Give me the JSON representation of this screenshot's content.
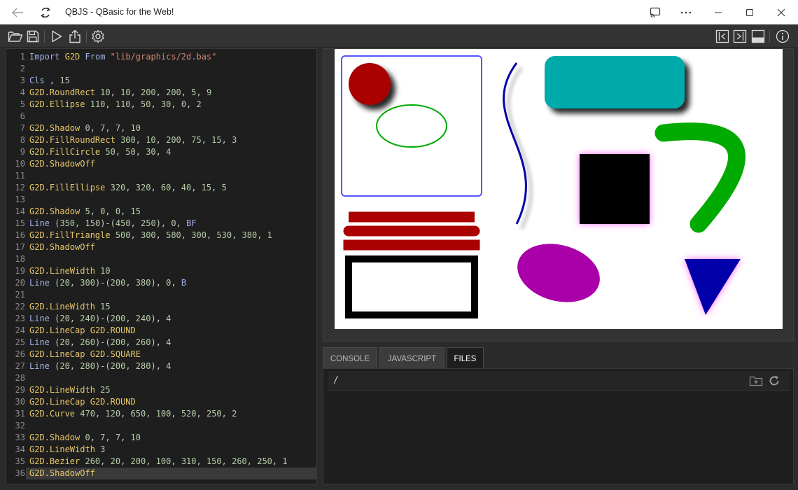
{
  "window": {
    "title": "QBJS - QBasic for the Web!"
  },
  "toolbar": {
    "left_icons": [
      "open-folder-icon",
      "save-icon",
      "run-icon",
      "share-icon",
      "settings-icon"
    ],
    "right_icons": [
      "collapse-left-icon",
      "collapse-right-icon",
      "bottom-panel-icon",
      "info-icon"
    ]
  },
  "editor": {
    "lines": [
      "Import G2D From \"lib/graphics/2d.bas\"",
      "",
      "Cls , 15",
      "G2D.RoundRect 10, 10, 200, 200, 5, 9",
      "G2D.Ellipse 110, 110, 50, 30, 0, 2",
      "",
      "G2D.Shadow 0, 7, 7, 10",
      "G2D.FillRoundRect 300, 10, 200, 75, 15, 3",
      "G2D.FillCircle 50, 50, 30, 4",
      "G2D.ShadowOff",
      "",
      "G2D.FillEllipse 320, 320, 60, 40, 15, 5",
      "",
      "G2D.Shadow 5, 0, 0, 15",
      "Line (350, 150)-(450, 250), 0, BF",
      "G2D.FillTriangle 500, 300, 580, 300, 530, 380, 1",
      "G2D.ShadowOff",
      "",
      "G2D.LineWidth 10",
      "Line (20, 300)-(200, 380), 0, B",
      "",
      "G2D.LineWidth 15",
      "Line (20, 240)-(200, 240), 4",
      "G2D.LineCap G2D.ROUND",
      "Line (20, 260)-(200, 260), 4",
      "G2D.LineCap G2D.SQUARE",
      "Line (20, 280)-(200, 280), 4",
      "",
      "G2D.LineWidth 25",
      "G2D.LineCap G2D.ROUND",
      "G2D.Curve 470, 120, 650, 100, 520, 250, 2",
      "",
      "G2D.Shadow 0, 7, 7, 10",
      "G2D.LineWidth 3",
      "G2D.Bezier 260, 20, 200, 100, 310, 150, 260, 250, 1",
      "G2D.ShadowOff"
    ],
    "active_line": 36
  },
  "tabs": [
    {
      "label": "CONSOLE",
      "active": false
    },
    {
      "label": "JAVASCRIPT",
      "active": false
    },
    {
      "label": "FILES",
      "active": true
    }
  ],
  "files": {
    "path": "/"
  },
  "colors": {
    "dark_red": "#aa0000",
    "teal": "#00aaaa",
    "green": "#00aa00",
    "magenta": "#aa00aa",
    "dark_blue": "#0000aa",
    "roundrect_border": "#5555ff",
    "black": "#000000"
  }
}
